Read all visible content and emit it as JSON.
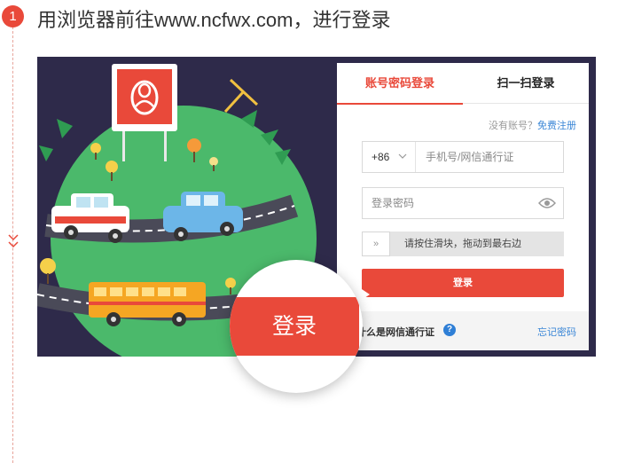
{
  "step": {
    "number": "1",
    "instruction": "用浏览器前往www.ncfwx.com，进行登录"
  },
  "login_panel": {
    "tabs": [
      {
        "label": "账号密码登录",
        "active": true
      },
      {
        "label": "扫一扫登录",
        "active": false
      }
    ],
    "register_prompt": "没有账号？",
    "register_link": "免费注册",
    "country_code": "+86",
    "phone_placeholder": "手机号/网信通行证",
    "password_placeholder": "登录密码",
    "slider_handle": "»",
    "slider_text": "请按住滑块，拖动到最右边",
    "login_button": "登录",
    "what_is": "什么是网信通行证",
    "help_icon": "?",
    "forgot_password": "忘记密码"
  },
  "magnifier": {
    "button_label": "登录"
  },
  "colors": {
    "accent": "#e9493a",
    "link": "#3a86d6",
    "backdrop": "#2e2a4a",
    "globe": "#4bb96b"
  },
  "icons": [
    "chevron-down-icon",
    "eye-icon",
    "help-icon",
    "double-chevron-right-icon",
    "brand-logo"
  ]
}
